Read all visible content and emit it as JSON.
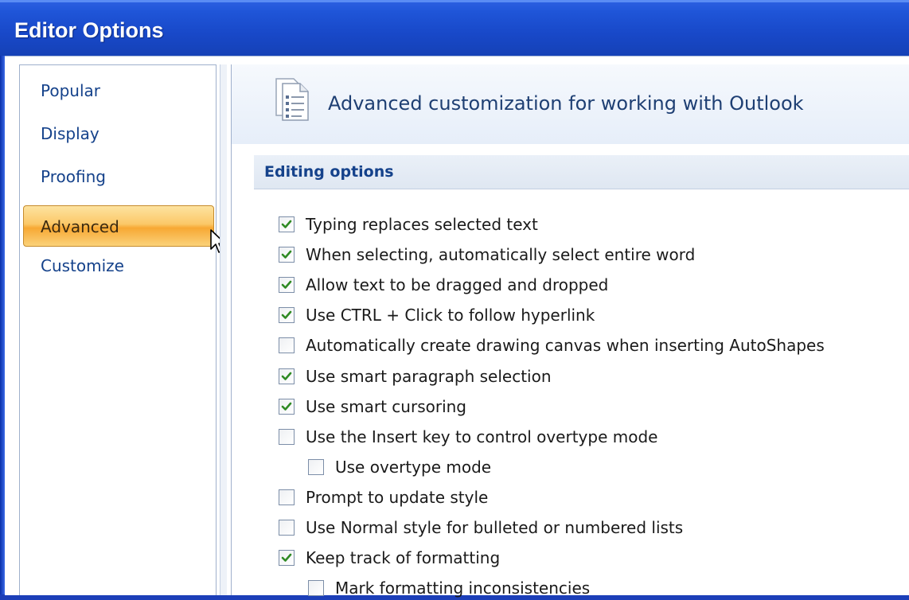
{
  "window": {
    "title": "Editor Options"
  },
  "sidebar": {
    "items": [
      {
        "label": "Popular",
        "active": false
      },
      {
        "label": "Display",
        "active": false
      },
      {
        "label": "Proofing",
        "active": false
      },
      {
        "label": "Advanced",
        "active": true
      },
      {
        "label": "Customize",
        "active": false
      }
    ]
  },
  "main": {
    "header": "Advanced customization for working with Outlook",
    "section_title": "Editing options",
    "options": [
      {
        "label": "Typing replaces selected text",
        "checked": true,
        "indent": false
      },
      {
        "label": "When selecting, automatically select entire word",
        "checked": true,
        "indent": false
      },
      {
        "label": "Allow text to be dragged and dropped",
        "checked": true,
        "indent": false
      },
      {
        "label": "Use CTRL + Click to follow hyperlink",
        "checked": true,
        "indent": false
      },
      {
        "label": "Automatically create drawing canvas when inserting AutoShapes",
        "checked": false,
        "indent": false
      },
      {
        "label": "Use smart paragraph selection",
        "checked": true,
        "indent": false
      },
      {
        "label": "Use smart cursoring",
        "checked": true,
        "indent": false
      },
      {
        "label": "Use the Insert key to control overtype mode",
        "checked": false,
        "indent": false
      },
      {
        "label": "Use overtype mode",
        "checked": false,
        "indent": true
      },
      {
        "label": "Prompt to update style",
        "checked": false,
        "indent": false
      },
      {
        "label": "Use Normal style for bulleted or numbered lists",
        "checked": false,
        "indent": false
      },
      {
        "label": "Keep track of formatting",
        "checked": true,
        "indent": false
      },
      {
        "label": "Mark formatting inconsistencies",
        "checked": false,
        "indent": true
      }
    ]
  },
  "colors": {
    "title_bar": "#1848c8",
    "accent_text": "#15428b",
    "active_nav": "#f7a833",
    "check_mark": "#2f8a24"
  },
  "icons": {
    "header": "document-list-icon",
    "check": "check-icon",
    "pointer": "mouse-pointer-icon"
  }
}
